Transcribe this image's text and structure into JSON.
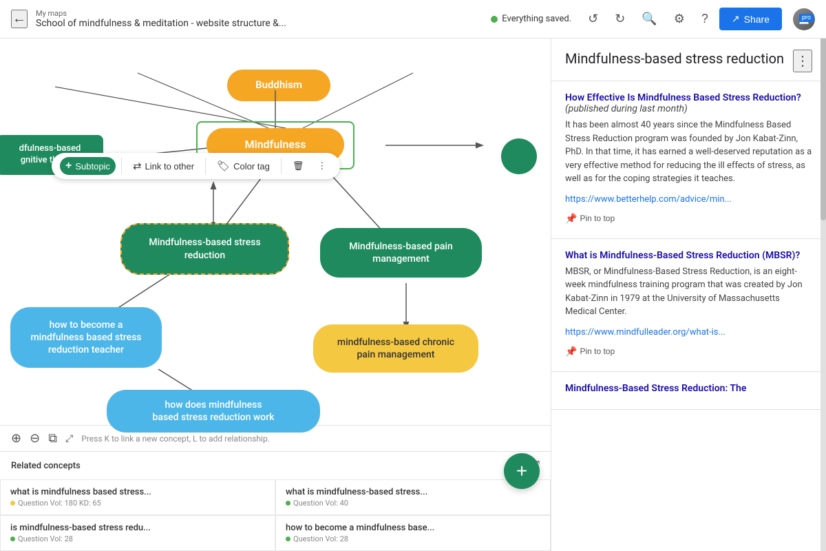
{
  "header": {
    "breadcrumb": "My maps",
    "title": "School of mindfulness & meditation - website structure &...",
    "status": "Everything saved.",
    "back_label": "←",
    "undo_label": "↺",
    "redo_label": "↻",
    "search_label": "🔍",
    "settings_label": "⚙",
    "help_label": "?",
    "share_label": "Share",
    "pro_label": "pro"
  },
  "toolbar": {
    "subtopic_label": "Subtopic",
    "link_label": "Link to other",
    "color_label": "Color tag",
    "delete_label": "🗑",
    "more_label": "⋮"
  },
  "nodes": {
    "buddhism": "Buddhism",
    "mindfulness": "Mindfulness",
    "cognitive": "dfulness-based\ngnitive therapy",
    "mbsr": "Mindfulness-based stress\nreduction",
    "pain": "Mindfulness-based pain\nmanagement",
    "teacher": "how to become a\nmindfulness based stress\nreduction teacher",
    "chronic": "mindfulness-based chronic\npain management",
    "work": "how does mindfulness\nbased stress reduction work"
  },
  "bottom": {
    "hint": "Press K to link a new concept, L to add relationship."
  },
  "related": {
    "header": "Related concepts",
    "items": [
      {
        "title": "what is mindfulness based stress...",
        "meta": "Question Vol: 180 KD: 65",
        "dot": "yellow"
      },
      {
        "title": "what is mindfulness-based stress...",
        "meta": "Question Vol: 40",
        "dot": "green"
      },
      {
        "title": "is mindfulness-based stress redu...",
        "meta": "Question Vol: 28",
        "dot": "green"
      },
      {
        "title": "how to become a mindfulness base...",
        "meta": "Question Vol: 28",
        "dot": "green"
      }
    ]
  },
  "right_panel": {
    "title": "Mindfulness-based stress reduction",
    "articles": [
      {
        "title": "How Effective Is Mindfulness Based Stress Reduction?",
        "title_extra": " (published during last month)",
        "body": "It has been almost 40 years since the Mindfulness Based Stress Reduction program was founded by Jon Kabat-Zinn, PhD. In that time, it has earned a well-deserved reputation as a very effective method for reducing the ill effects of stress, as well as for the coping strategies it teaches.",
        "link": "https://www.betterhelp.com/advice/min...",
        "pin_label": "Pin to top"
      },
      {
        "title": "What is Mindfulness-Based Stress Reduction (MBSR)?",
        "title_extra": "",
        "body": "MBSR, or Mindfulness-Based Stress Reduction, is an eight-week mindfulness training program that was created by Jon Kabat-Zinn in 1979 at the University of Massachusetts Medical Center.",
        "link": "https://www.mindfulleader.org/what-is...",
        "pin_label": "Pin to top"
      },
      {
        "title": "Mindfulness-Based Stress Reduction: The",
        "title_extra": "",
        "body": "",
        "link": "",
        "pin_label": ""
      }
    ]
  }
}
